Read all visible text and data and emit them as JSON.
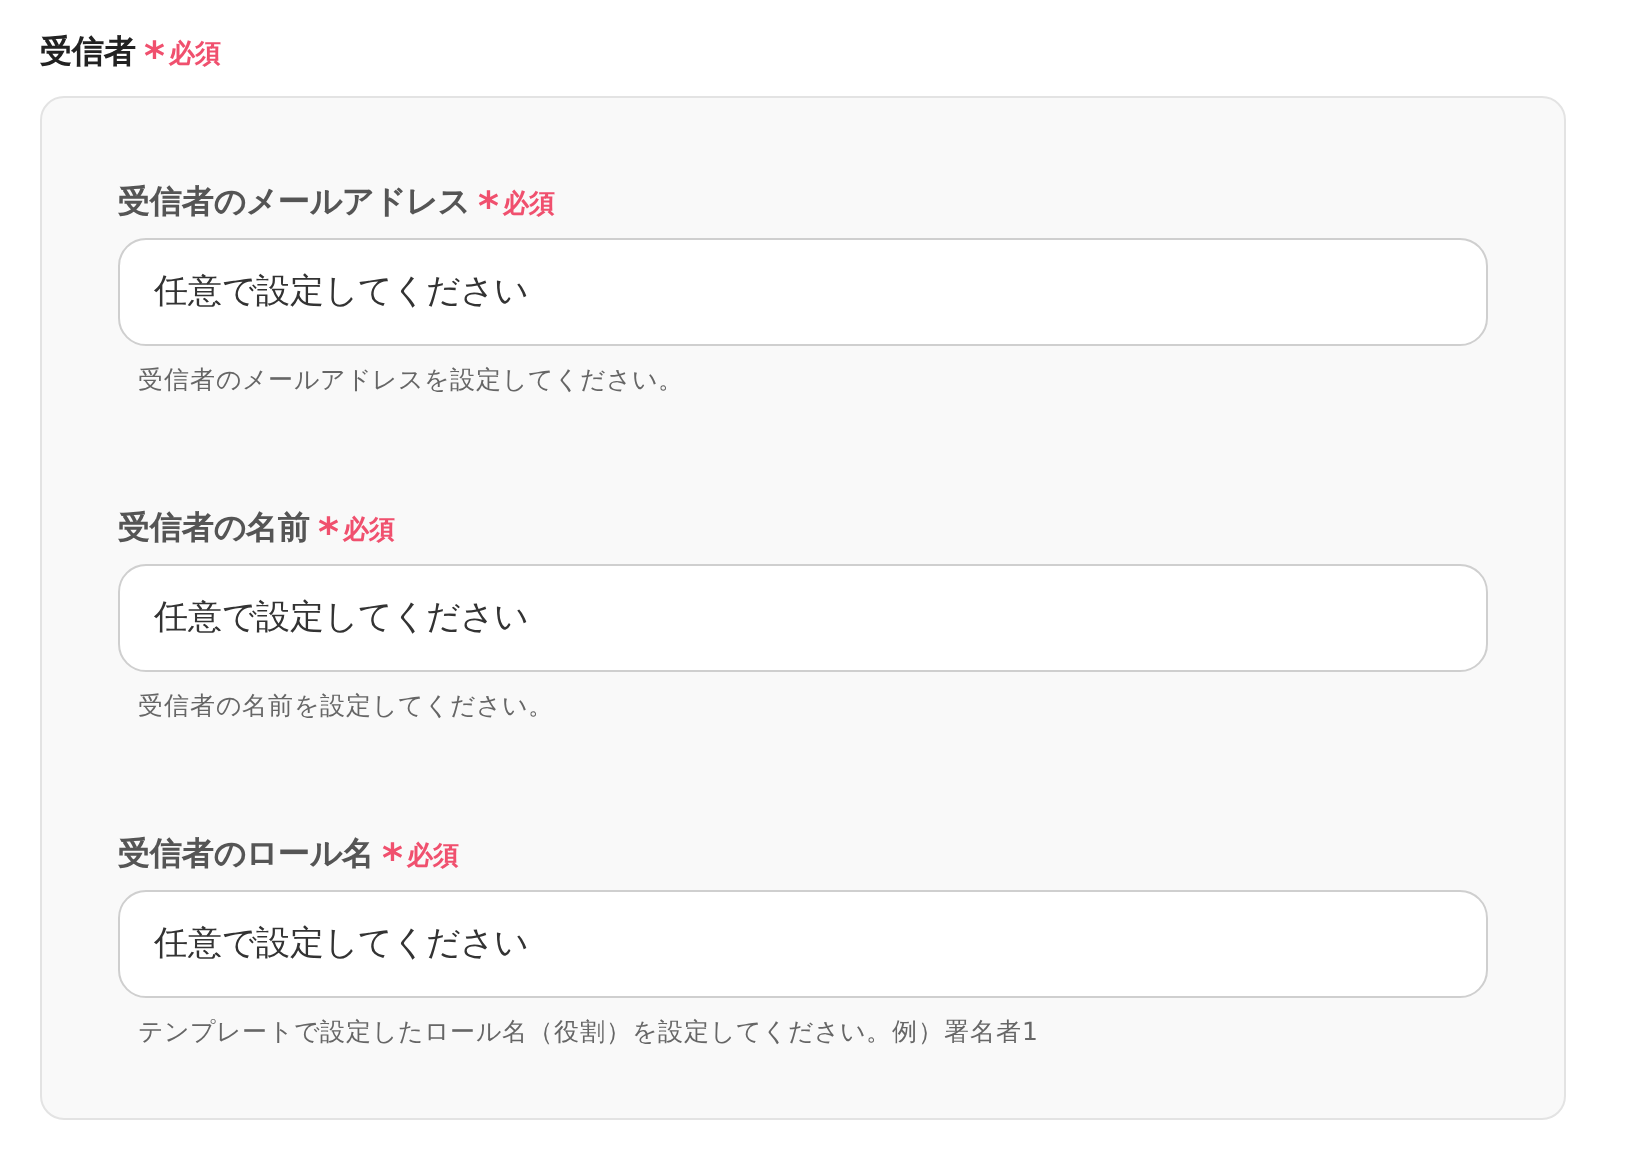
{
  "section": {
    "label": "受信者",
    "required_mark": "*",
    "required_text": "必須"
  },
  "fields": [
    {
      "label": "受信者のメールアドレス",
      "required_mark": "*",
      "required_text": "必須",
      "placeholder": "任意で設定してください",
      "help": "受信者のメールアドレスを設定してください。"
    },
    {
      "label": "受信者の名前",
      "required_mark": "*",
      "required_text": "必須",
      "placeholder": "任意で設定してください",
      "help": "受信者の名前を設定してください。"
    },
    {
      "label": "受信者のロール名",
      "required_mark": "*",
      "required_text": "必須",
      "placeholder": "任意で設定してください",
      "help": "テンプレートで設定したロール名（役割）を設定してください。例）署名者1"
    }
  ]
}
